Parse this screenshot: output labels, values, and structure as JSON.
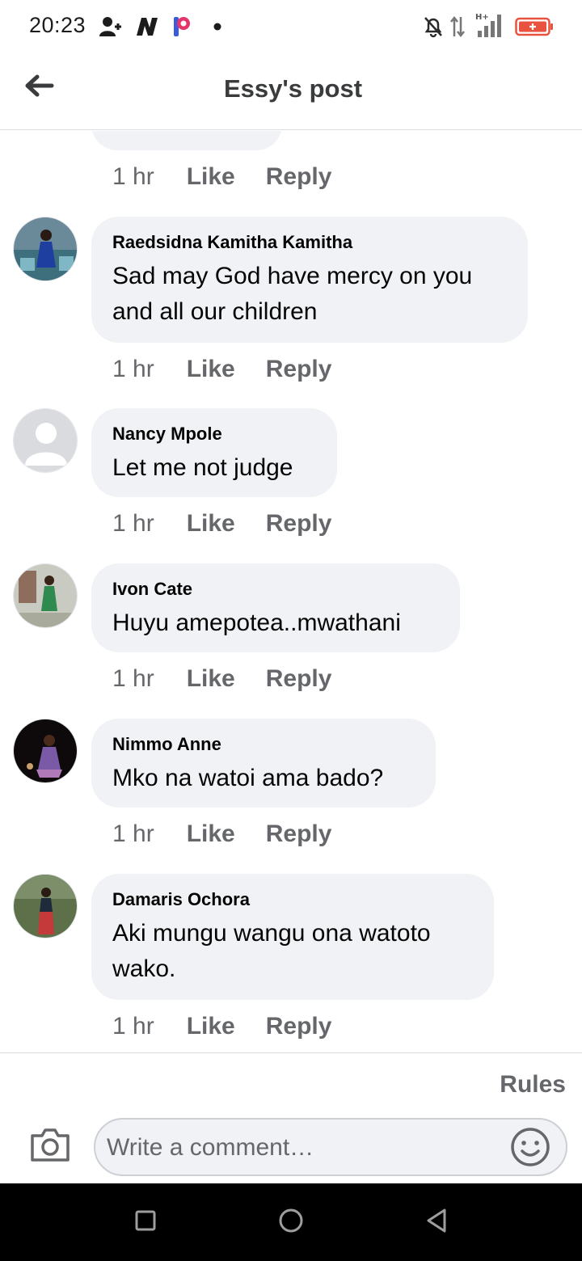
{
  "status_bar": {
    "time": "20:23",
    "icons": [
      "add-person-icon",
      "n-logo-icon",
      "p-logo-icon",
      "dot-icon",
      "silent-bell-icon",
      "data-transfer-icon",
      "hplus-signal-icon",
      "battery-icon"
    ],
    "signal_label": "H+"
  },
  "header": {
    "title": "Essy's post",
    "back_icon": "arrow-left-icon"
  },
  "comments": [
    {
      "author": "Raedsidna Kamitha Kamitha",
      "text": "Sad may God have mercy on you and all our children",
      "time": "1 hr",
      "like": "Like",
      "reply": "Reply"
    },
    {
      "author": "Nancy Mpole",
      "text": "Let me not judge",
      "time": "1 hr",
      "like": "Like",
      "reply": "Reply"
    },
    {
      "author": "Ivon Cate",
      "text": "Huyu amepotea..mwathani",
      "time": "1 hr",
      "like": "Like",
      "reply": "Reply"
    },
    {
      "author": "Nimmo Anne",
      "text": "Mko na watoi ama bado?",
      "time": "1 hr",
      "like": "Like",
      "reply": "Reply"
    },
    {
      "author": "Damaris Ochora",
      "text": "Aki mungu wangu ona watoto wako.",
      "time": "1 hr",
      "like": "Like",
      "reply": "Reply"
    }
  ],
  "previous_comment_actions": {
    "time": "1 hr",
    "like": "Like",
    "reply": "Reply"
  },
  "composer": {
    "rules": "Rules",
    "placeholder": "Write a comment…"
  },
  "colors": {
    "bubble": "#f0f2f5",
    "secondary_text": "#65676b",
    "battery": "#e8523f"
  }
}
